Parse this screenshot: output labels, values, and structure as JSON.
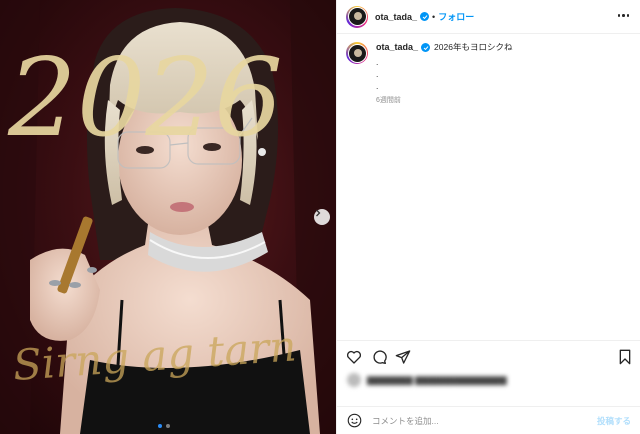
{
  "post": {
    "username": "ota_tada_",
    "separator": "•",
    "follow_label": "フォロー",
    "caption_text": "2026年もヨロシクね",
    "caption_extra": [
      ".",
      ".",
      "."
    ],
    "time_ago": "6週間前",
    "photo_text": {
      "year": "2026",
      "script": "Sirng ag tarn"
    }
  },
  "carousel": {
    "current": 1,
    "total": 2
  },
  "comment": {
    "placeholder": "コメントを追加...",
    "post_label": "投稿する"
  },
  "colors": {
    "accent": "#0095f6",
    "gold": "#e8d7a0",
    "dot_active": "#2a8cf6"
  },
  "icons": [
    "heart-icon",
    "comment-icon",
    "share-icon",
    "bookmark-icon",
    "emoji-icon",
    "more-icon",
    "chevron-right-icon"
  ]
}
